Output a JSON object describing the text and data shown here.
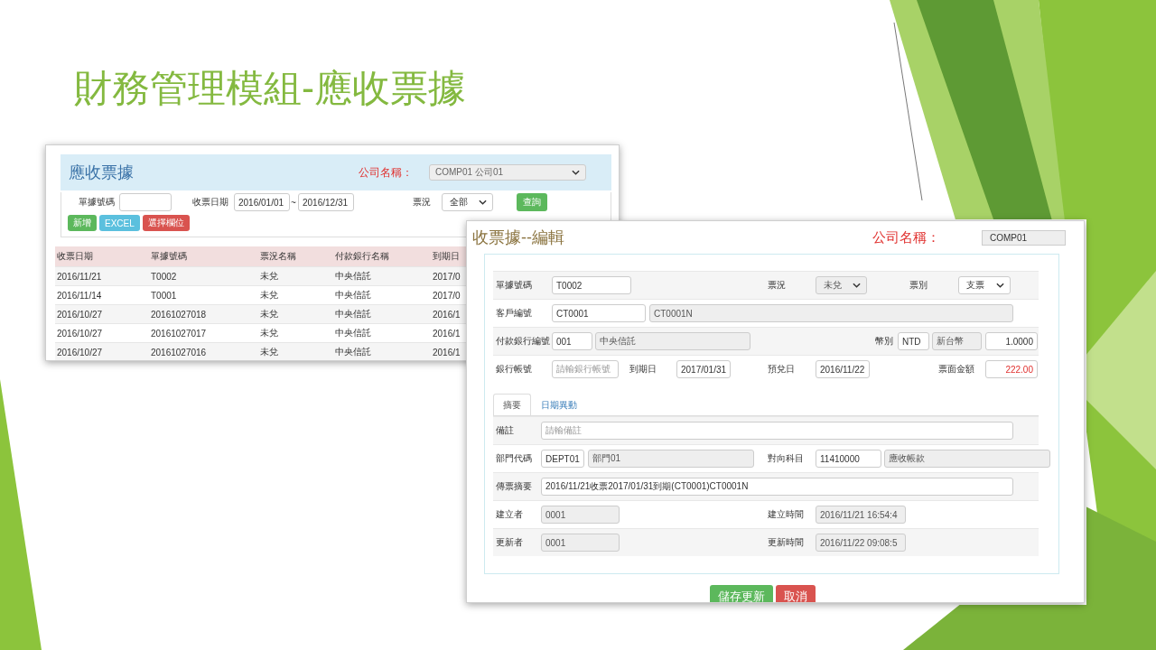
{
  "slide": {
    "title": "財務管理模組-應收票據"
  },
  "list_screen": {
    "title": "應收票據",
    "company_label": "公司名稱：",
    "company_select": "COMP01 公司01",
    "filters": [
      {
        "kind": "label",
        "text": "單據號碼"
      },
      {
        "kind": "input"
      },
      {
        "kind": "label",
        "text": "收票日期"
      },
      {
        "kind": "input",
        "value": "2016/01/01"
      },
      {
        "kind": "label",
        "text": "~"
      },
      {
        "kind": "input",
        "value": "2016/12/31"
      },
      {
        "kind": "label",
        "text": "票況"
      },
      {
        "kind": "select",
        "value": "全部"
      },
      {
        "kind": "button",
        "text": "查詢",
        "color": "#5cb85c"
      }
    ],
    "buttons": [
      {
        "label": "新增",
        "color": "#5cb85c"
      },
      {
        "label": "EXCEL",
        "color": "#5bc0de"
      },
      {
        "label": "選擇欄位",
        "color": "#d9534f"
      }
    ],
    "table": {
      "columns": [
        "收票日期",
        "單據號碼",
        "票況名稱",
        "付款銀行名稱",
        "到期日"
      ],
      "rows": [
        [
          "2016/11/21",
          "T0002",
          "未兌",
          "中央信託",
          "2017/0"
        ],
        [
          "2016/11/14",
          "T0001",
          "未兌",
          "中央信託",
          "2017/0"
        ],
        [
          "2016/10/27",
          "20161027018",
          "未兌",
          "中央信託",
          "2016/1"
        ],
        [
          "2016/10/27",
          "20161027017",
          "未兌",
          "中央信託",
          "2016/1"
        ],
        [
          "2016/10/27",
          "20161027016",
          "未兌",
          "中央信託",
          "2016/1"
        ]
      ]
    }
  },
  "edit_screen": {
    "title": "收票據--編輯",
    "company_label": "公司名稱：",
    "company_value": "COMP01",
    "rows": [
      {
        "items": [
          {
            "kind": "label",
            "text": "單據號碼"
          },
          {
            "kind": "text",
            "value": "T0002",
            "disabled": false
          },
          {
            "kind": "label",
            "text": "票況"
          },
          {
            "kind": "select",
            "value": "未兌",
            "disabled": true
          },
          {
            "kind": "label",
            "text": "票別"
          },
          {
            "kind": "select",
            "value": "支票",
            "disabled": false
          }
        ]
      },
      {
        "items": [
          {
            "kind": "label",
            "text": "客戶編號"
          },
          {
            "kind": "text",
            "value": "CT0001",
            "disabled": false
          },
          {
            "kind": "text",
            "value": "CT0001N",
            "disabled": true
          }
        ]
      },
      {
        "items": [
          {
            "kind": "label",
            "text": "付款銀行編號"
          },
          {
            "kind": "text",
            "value": "001",
            "disabled": false
          },
          {
            "kind": "text",
            "value": "中央信託",
            "disabled": true
          },
          {
            "kind": "label",
            "text": "幣別"
          },
          {
            "kind": "text",
            "value": "NTD",
            "disabled": false
          },
          {
            "kind": "text",
            "value": "新台幣",
            "disabled": true
          },
          {
            "kind": "number",
            "value": "1.0000",
            "disabled": false
          }
        ]
      },
      {
        "items": [
          {
            "kind": "label",
            "text": "銀行帳號"
          },
          {
            "kind": "text",
            "placeholder": "請輸銀行帳號",
            "disabled": false
          },
          {
            "kind": "label",
            "text": "到期日"
          },
          {
            "kind": "text",
            "value": "2017/01/31",
            "disabled": false
          },
          {
            "kind": "label",
            "text": "預兌日"
          },
          {
            "kind": "text",
            "value": "2016/11/22",
            "disabled": false
          },
          {
            "kind": "label",
            "text": "票面金額"
          },
          {
            "kind": "amount",
            "value": "222.00",
            "disabled": false
          }
        ]
      }
    ],
    "tabs": [
      {
        "label": "摘要",
        "selected": true
      },
      {
        "label": "日期異動",
        "selected": false
      }
    ],
    "tab_rows": [
      {
        "items": [
          {
            "kind": "label",
            "text": "備註"
          },
          {
            "kind": "text",
            "placeholder": "請輸備註",
            "disabled": false
          }
        ]
      },
      {
        "items": [
          {
            "kind": "label",
            "text": "部門代碼"
          },
          {
            "kind": "text",
            "value": "DEPT01",
            "disabled": false
          },
          {
            "kind": "text",
            "value": "部門01",
            "disabled": true
          },
          {
            "kind": "label",
            "text": "對向科目"
          },
          {
            "kind": "text",
            "value": "11410000",
            "disabled": false
          },
          {
            "kind": "text",
            "value": "應收帳款",
            "disabled": true
          }
        ]
      },
      {
        "items": [
          {
            "kind": "label",
            "text": "傳票摘要"
          },
          {
            "kind": "text",
            "value": "2016/11/21收票2017/01/31到期(CT0001)CT0001N",
            "disabled": false
          }
        ]
      },
      {
        "items": [
          {
            "kind": "label",
            "text": "建立者"
          },
          {
            "kind": "text",
            "value": "0001",
            "disabled": true
          },
          {
            "kind": "label",
            "text": "建立時間"
          },
          {
            "kind": "text",
            "value": "2016/11/21 16:54:4",
            "disabled": true
          }
        ]
      },
      {
        "items": [
          {
            "kind": "label",
            "text": "更新者"
          },
          {
            "kind": "text",
            "value": "0001",
            "disabled": true
          },
          {
            "kind": "label",
            "text": "更新時間"
          },
          {
            "kind": "text",
            "value": "2016/11/22 09:08:5",
            "disabled": true
          }
        ]
      }
    ],
    "buttons": [
      {
        "label": "儲存更新",
        "color": "#5cb85c"
      },
      {
        "label": "取消",
        "color": "#d9534f"
      }
    ]
  }
}
